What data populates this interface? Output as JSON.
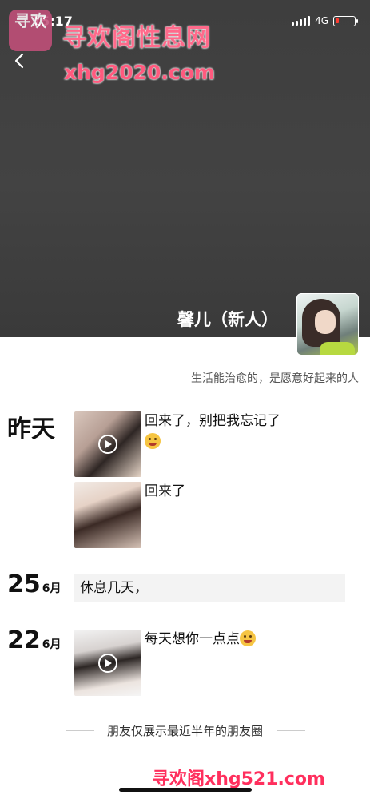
{
  "status_bar": {
    "time": "15:17",
    "network": "4G"
  },
  "watermark": {
    "logo_text": "寻欢",
    "title": "寻欢阁性息网",
    "url": "xhg2020.com",
    "bottom_url": "寻欢阁xhg521.com"
  },
  "profile": {
    "nickname": "馨儿（新人）",
    "signature": "生活能治愈的，是愿意好起来的人"
  },
  "posts": [
    {
      "date_label": "昨天",
      "items": [
        {
          "kind": "video",
          "text": "回来了，别把我忘记了"
        },
        {
          "kind": "photo",
          "text": "回来了"
        }
      ]
    },
    {
      "date_day": "25",
      "date_month": "6月",
      "items": [
        {
          "kind": "text",
          "text": "休息几天，"
        }
      ]
    },
    {
      "date_day": "22",
      "date_month": "6月",
      "items": [
        {
          "kind": "video",
          "text": "每天想你一点点"
        }
      ]
    }
  ],
  "footer_note": "朋友仅展示最近半年的朋友圈",
  "icons": {
    "back": "chevron-left-icon",
    "play": "play-icon",
    "signal": "signal-icon",
    "battery": "battery-icon"
  },
  "colors": {
    "cover_bg": "#404040",
    "watermark_pink": "#ff5a7e",
    "battery_low": "#ff3b30"
  }
}
